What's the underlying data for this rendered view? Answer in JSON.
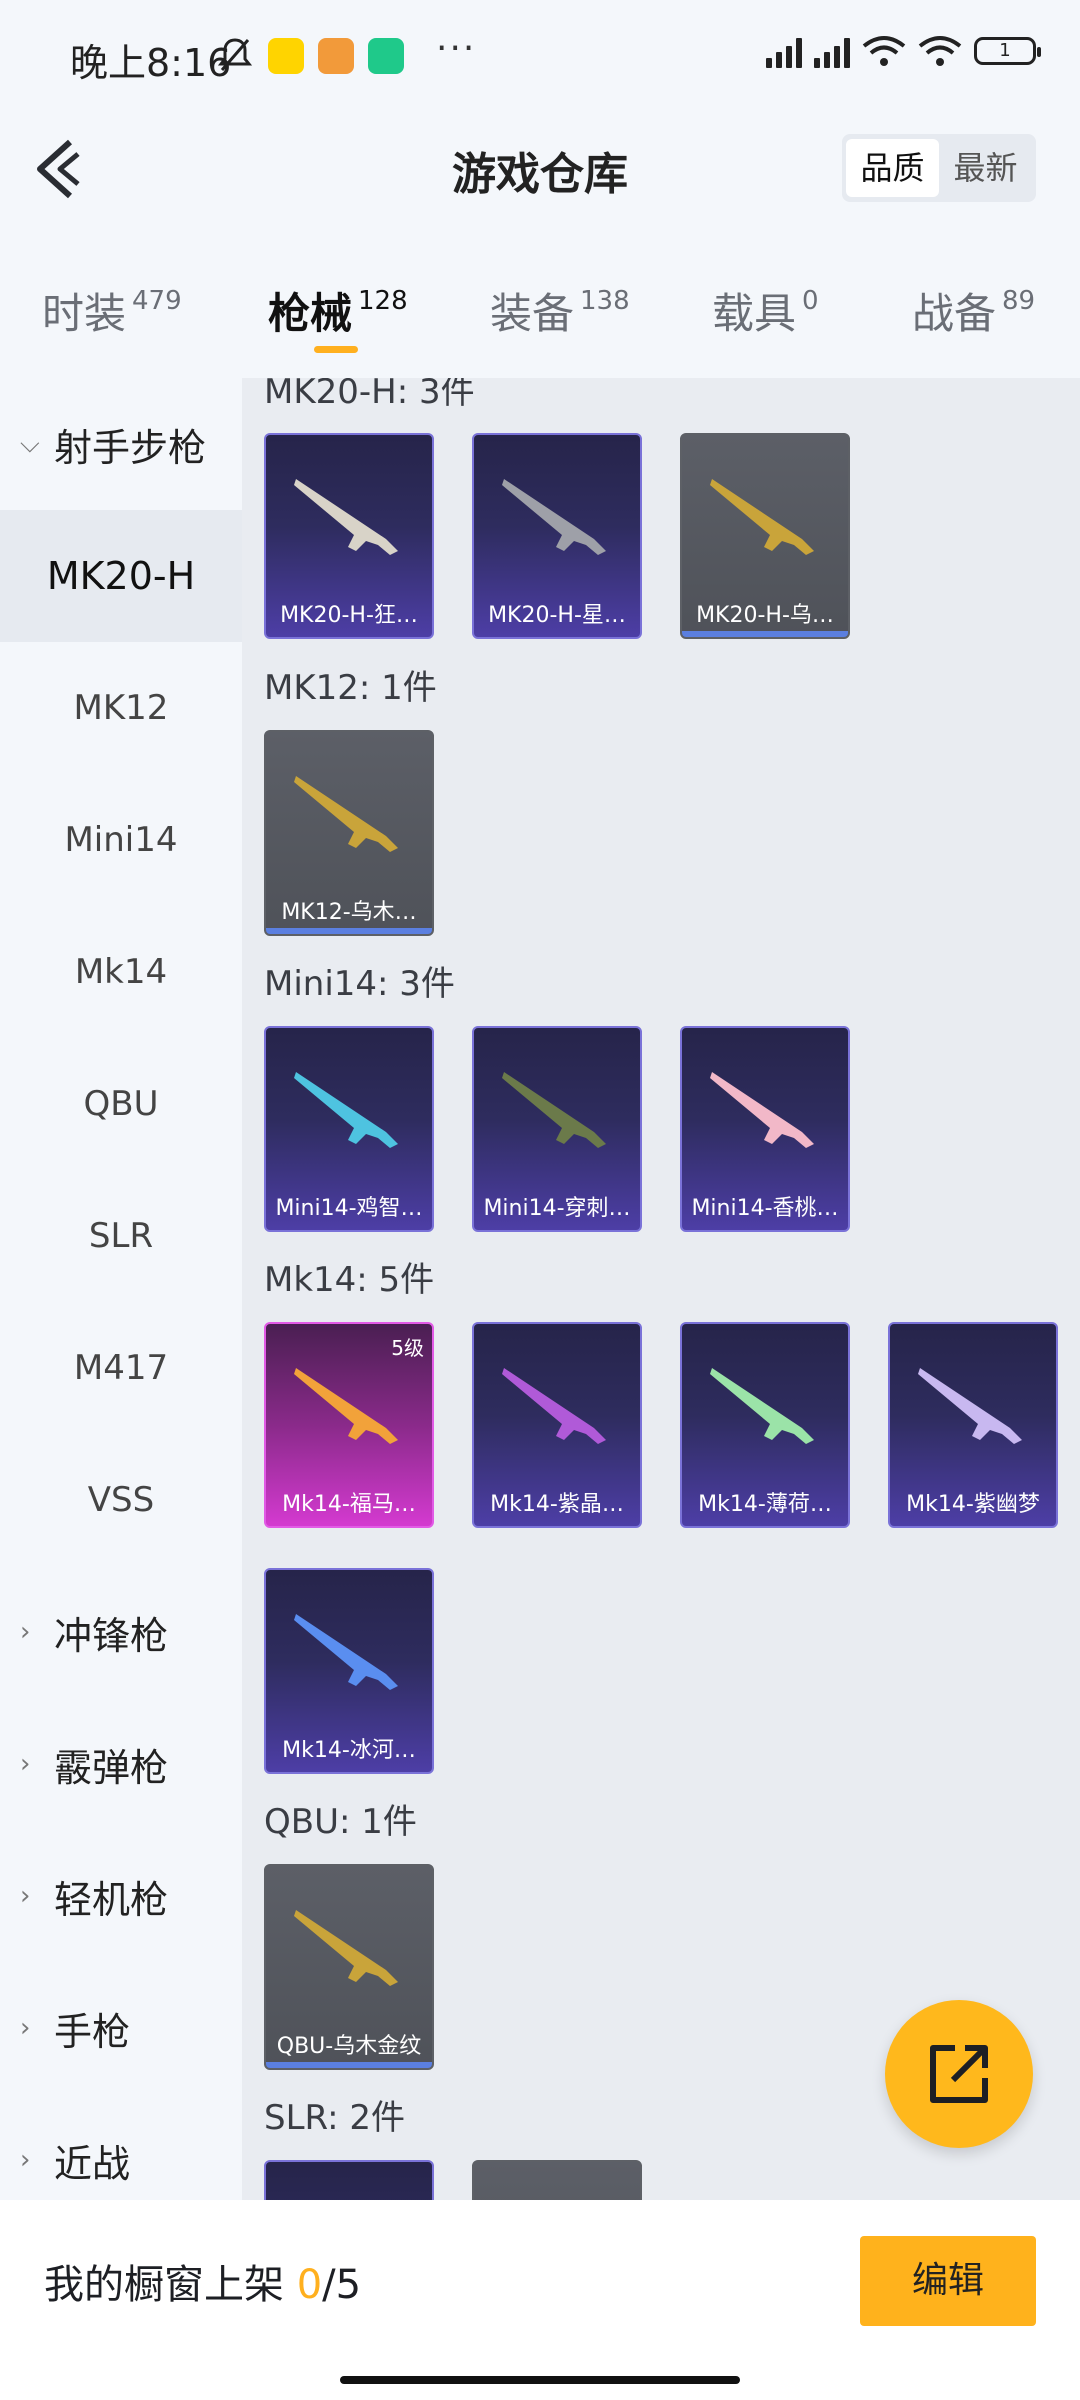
{
  "status_bar": {
    "time": "晚上8:16",
    "battery": "1"
  },
  "header": {
    "title": "游戏仓库",
    "sort_options": [
      "品质",
      "最新"
    ]
  },
  "tabs": [
    {
      "label": "时装",
      "count": "479"
    },
    {
      "label": "枪械",
      "count": "128"
    },
    {
      "label": "装备",
      "count": "138"
    },
    {
      "label": "载具",
      "count": "0"
    },
    {
      "label": "战备",
      "count": "89"
    }
  ],
  "sidebar": {
    "groups": [
      {
        "label": "射手步枪"
      },
      {
        "label": "冲锋枪"
      },
      {
        "label": "霰弹枪"
      },
      {
        "label": "轻机枪"
      },
      {
        "label": "手枪"
      },
      {
        "label": "近战"
      }
    ],
    "sub_items": [
      "MK20-H",
      "MK12",
      "Mini14",
      "Mk14",
      "QBU",
      "SLR",
      "M417",
      "VSS"
    ]
  },
  "sections": [
    {
      "title": "MK20-H: 3件",
      "items": [
        "MK20-H-狂…",
        "MK20-H-星…",
        "MK20-H-乌…"
      ]
    },
    {
      "title": "MK12: 1件",
      "items": [
        "MK12-乌木…"
      ]
    },
    {
      "title": "Mini14: 3件",
      "items": [
        "Mini14-鸡智…",
        "Mini14-穿刺…",
        "Mini14-香桃…"
      ]
    },
    {
      "title": "Mk14: 5件",
      "items": [
        "Mk14-福马…",
        "Mk14-紫晶…",
        "Mk14-薄荷…",
        "Mk14-紫幽梦",
        "Mk14-冰河…"
      ],
      "level": "5级"
    },
    {
      "title": "QBU: 1件",
      "items": [
        "QBU-乌木金纹"
      ]
    },
    {
      "title": "SLR: 2件",
      "items": []
    }
  ],
  "bottom_bar": {
    "showcase_label": "我的橱窗上架",
    "showcase_count": "0",
    "showcase_total": "/5",
    "edit_label": "编辑"
  },
  "colors": {
    "accent": "#ffb01f",
    "card_purple": "#4d3ea6",
    "card_gray": "#5c5f67",
    "card_pink": "#d43ad0"
  }
}
